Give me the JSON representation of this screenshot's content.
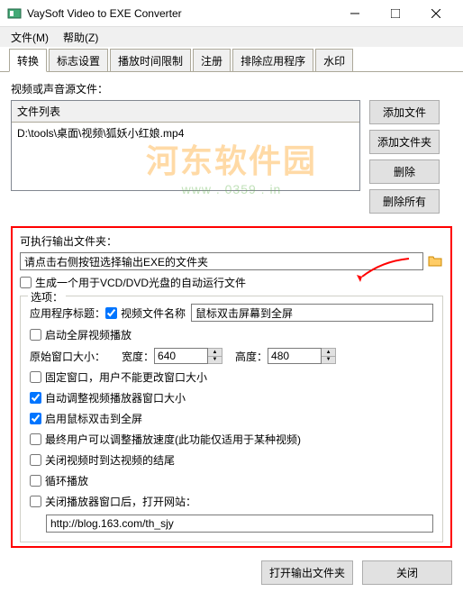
{
  "window": {
    "title": "VaySoft Video to EXE Converter"
  },
  "menu": {
    "file": "文件(M)",
    "help": "帮助(Z)"
  },
  "tabs": {
    "t1": "转换",
    "t2": "标志设置",
    "t3": "播放时间限制",
    "t4": "注册",
    "t5": "排除应用程序",
    "t6": "水印"
  },
  "section": {
    "video_label": "视频或声音源文件：",
    "filelist_hdr": "文件列表",
    "file_item": "D:\\tools\\桌面\\视频\\狐妖小红娘.mp4"
  },
  "buttons": {
    "add_file": "添加文件",
    "add_folder": "添加文件夹",
    "delete": "删除",
    "delete_all": "删除所有",
    "open_folder": "打开输出文件夹",
    "close": "关闭"
  },
  "output": {
    "label": "可执行输出文件夹：",
    "placeholder": "请点击右侧按钮选择输出EXE的文件夹",
    "vcd": "生成一个用于VCD/DVD光盘的自动运行文件",
    "options": "选项：",
    "app_title": "应用程序标题：",
    "video_name": "视频文件名称",
    "title_value": "鼠标双击屏幕到全屏",
    "fullscreen": "启动全屏视频播放",
    "orig_size": "原始窗口大小：",
    "width": "宽度：",
    "width_v": "640",
    "height": "高度：",
    "height_v": "480",
    "fixed": "固定窗口，用户不能更改窗口大小",
    "auto_adjust": "自动调整视频播放器窗口大小",
    "dblclick": "启用鼠标双击到全屏",
    "speed": "最终用户可以调整播放速度(此功能仅适用于某种视频)",
    "close_end": "关闭视频时到达视频的结尾",
    "loop": "循环播放",
    "open_url": "关闭播放器窗口后，打开网站：",
    "url": "http://blog.163.com/th_sjy"
  },
  "watermark": {
    "text": "河东软件园",
    "url": "www . 0359 . in"
  }
}
